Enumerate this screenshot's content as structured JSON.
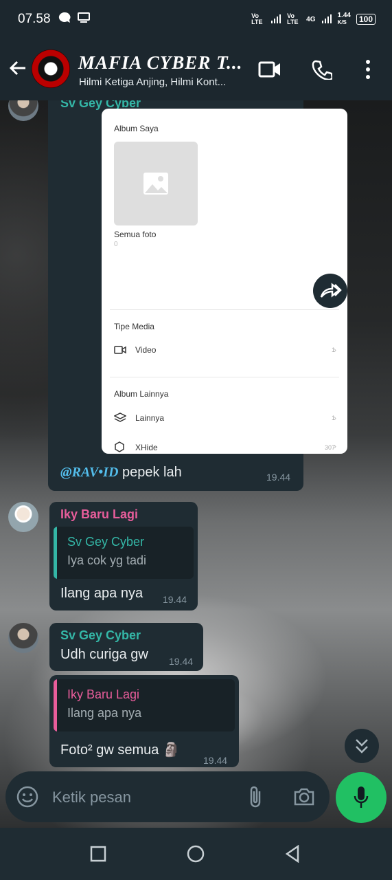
{
  "status_bar": {
    "time": "07.58",
    "network_1": "Vo LTE",
    "network_2": "Vo LTE",
    "network_3": "4G",
    "speed": "1.44",
    "speed_unit": "K/S",
    "battery": "100"
  },
  "header": {
    "title": "MAFIA CYBER T...",
    "subtitle": "Hilmi Ketiga Anjing, Hilmi Kont..."
  },
  "screenshot_card": {
    "sender_partial": "Sv Gey Cyber",
    "album_saya": "Album Saya",
    "semua_foto": "Semua foto",
    "semua_foto_count": "0",
    "tipe_media": "Tipe Media",
    "video_label": "Video",
    "video_count": "1",
    "album_lainnya": "Album Lainnya",
    "lainnya_label": "Lainnya",
    "lainnya_count": "1",
    "xhide_label": "XHide",
    "xhide_count": "307"
  },
  "messages": [
    {
      "mention": "@RAV•ID",
      "text": " pepek lah",
      "time": "19.44"
    },
    {
      "sender": "Iky Baru Lagi",
      "quote_name": "Sv Gey Cyber",
      "quote_text": "Iya cok yg tadi",
      "text": "Ilang apa nya",
      "time": "19.44"
    },
    {
      "sender": "Sv Gey Cyber",
      "text": "Udh curiga gw",
      "time": "19.44"
    },
    {
      "quote_name": "Iky Baru Lagi",
      "quote_text": "Ilang apa nya",
      "text": "Foto² gw semua 🗿",
      "time": "19.44"
    }
  ],
  "input": {
    "placeholder": "Ketik pesan"
  },
  "colors": {
    "header_bg": "#1c272e",
    "bubble_bg": "#1f2c33",
    "teal_name": "#34b7a7",
    "pink_name": "#e85d9b",
    "mic_green": "#21c063"
  }
}
